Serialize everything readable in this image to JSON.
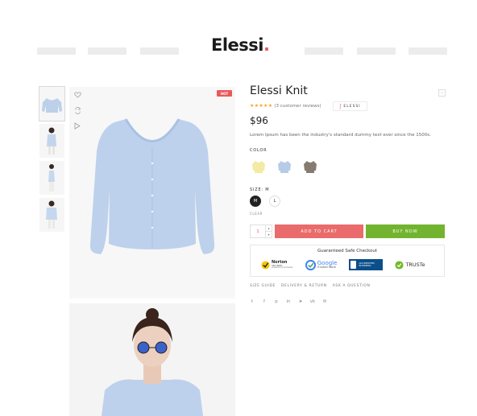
{
  "header": {
    "logo_text": "Elessi",
    "logo_dot": ".",
    "nav_placeholders": 6
  },
  "gallery": {
    "badge": "HOT",
    "thumbnails": [
      "thumb-cardigan",
      "thumb-model-front",
      "thumb-model-side",
      "thumb-model-back"
    ],
    "side_icons": [
      "heart-icon",
      "compare-icon",
      "play-icon"
    ]
  },
  "product": {
    "title": "Elessi Knit",
    "stars": "★★★★★",
    "reviews": "(3 customer reviews)",
    "brand": "ELESSI",
    "price": "$96",
    "description": "Lorem Ipsum has been the industry's standard dummy text ever since the 1500s.",
    "color_label": "COLOR",
    "colors": [
      "#f3eaa3",
      "#b7cbe6",
      "#867b72"
    ],
    "size_label": "SIZE: M",
    "sizes": [
      "M",
      "L"
    ],
    "selected_size": "M",
    "clear_label": "CLEAR",
    "quantity": "1",
    "qty_up": "▴",
    "qty_down": "▾",
    "add_to_cart": "ADD TO CART",
    "buy_now": "BUY NOW"
  },
  "checkout": {
    "title": "Guaranteed Safe Checkout",
    "norton": "Norton",
    "norton_sub": "SECURED",
    "norton_by": "powered by Symantec",
    "google_1": "Google",
    "google_2": "Trusted Store",
    "bbb_1": "ACCREDITED",
    "bbb_2": "BUSINESS",
    "truste": "TRUSTe"
  },
  "links": [
    "SIZE GUIDE",
    "DELIVERY & RETURN",
    "ASK A QUESTION"
  ],
  "social": [
    {
      "name": "twitter-icon",
      "glyph": "t"
    },
    {
      "name": "facebook-icon",
      "glyph": "f"
    },
    {
      "name": "pinterest-icon",
      "glyph": "p"
    },
    {
      "name": "linkedin-icon",
      "glyph": "in"
    },
    {
      "name": "telegram-icon",
      "glyph": "➤"
    },
    {
      "name": "vk-icon",
      "glyph": "vk"
    },
    {
      "name": "email-icon",
      "glyph": "✉"
    }
  ]
}
